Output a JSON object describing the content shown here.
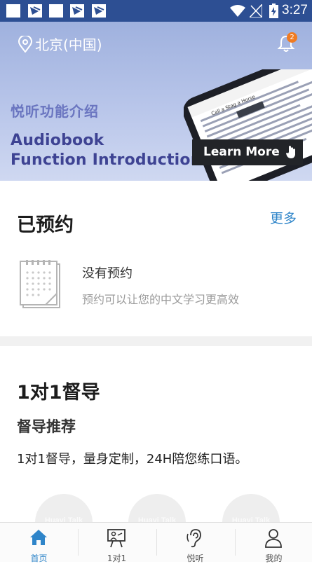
{
  "status_bar": {
    "time": "3:27"
  },
  "banner": {
    "location": "北京(中国)",
    "notification_count": "2",
    "title_cn": "悦听功能介绍",
    "title_en_line1": "Audiobook",
    "title_en_line2": "Function Introduction",
    "learn_more": "Learn More",
    "phone_title": "Call a Stag a Horse"
  },
  "reservations": {
    "title": "已预约",
    "more": "更多",
    "empty_title": "没有预约",
    "empty_subtitle": "预约可以让您的中文学习更高效"
  },
  "tutoring": {
    "title": "1对1督导",
    "subtitle": "督导推荐",
    "description": "1对1督导，量身定制，24H陪您练口语。",
    "tutor_watermark": "Huayi Talk"
  },
  "bottom_nav": {
    "items": [
      {
        "label": "首页",
        "icon": "home-icon",
        "active": true
      },
      {
        "label": "1对1",
        "icon": "presentation-icon",
        "active": false
      },
      {
        "label": "悦听",
        "icon": "ear-icon",
        "active": false
      },
      {
        "label": "我的",
        "icon": "user-icon",
        "active": false
      }
    ]
  },
  "colors": {
    "status_bar": "#2d4f93",
    "accent": "#2f85c9",
    "nav_active": "#2f85c9",
    "badge": "#f07b22"
  }
}
